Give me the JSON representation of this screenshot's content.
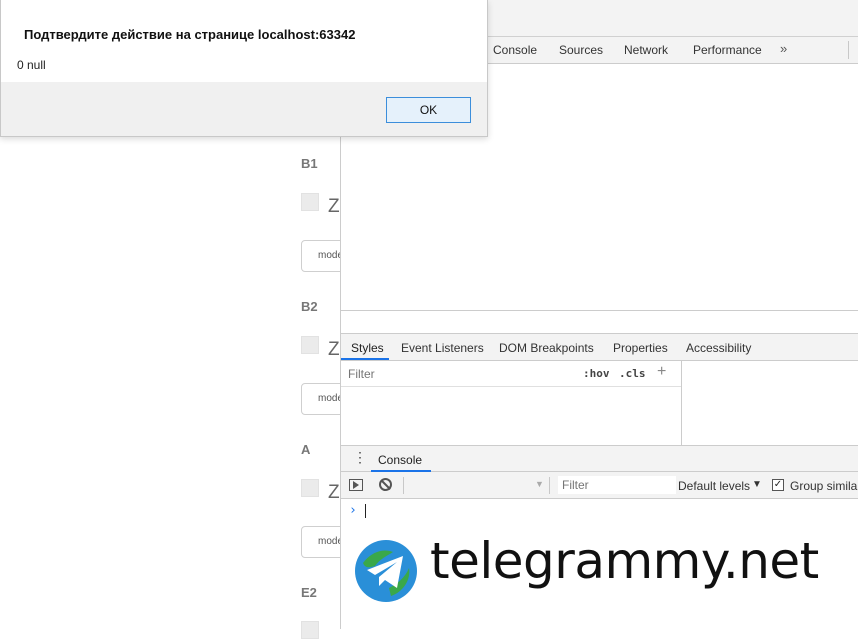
{
  "dialog": {
    "title": "Подтвердите действие на странице localhost:63342",
    "message": "0 null",
    "ok_label": "OK"
  },
  "page": {
    "sections": [
      {
        "label": "B1",
        "z_text": "Z",
        "mode_text": "mode"
      },
      {
        "label": "B2",
        "z_text": "Z",
        "mode_text": "mode"
      },
      {
        "label": "A",
        "z_text": "Z",
        "mode_text": "mode"
      },
      {
        "label": "E2"
      }
    ]
  },
  "devtools": {
    "main_tabs": [
      "Console",
      "Sources",
      "Network",
      "Performance"
    ],
    "more_tabs_glyph": "»",
    "close_glyph": "⋮",
    "sub_tabs": [
      "Styles",
      "Event Listeners",
      "DOM Breakpoints",
      "Properties",
      "Accessibility"
    ],
    "styles": {
      "filter_placeholder": "Filter",
      "hov_label": ":hov",
      "cls_label": ".cls",
      "add_rule_glyph": "+"
    },
    "drawer": {
      "menu_glyph": "⋮",
      "tab_label": "Console"
    },
    "console_toolbar": {
      "context_arrow": "▼",
      "filter_placeholder": "Filter",
      "levels_label": "Default levels",
      "levels_arrow": "▼",
      "group_checkbox_mark": "✓",
      "group_label": "Group similar"
    },
    "console": {
      "prompt_glyph": "›"
    },
    "accent_color": "#1a73e8"
  },
  "watermark": {
    "text": "telegrammy.net"
  }
}
